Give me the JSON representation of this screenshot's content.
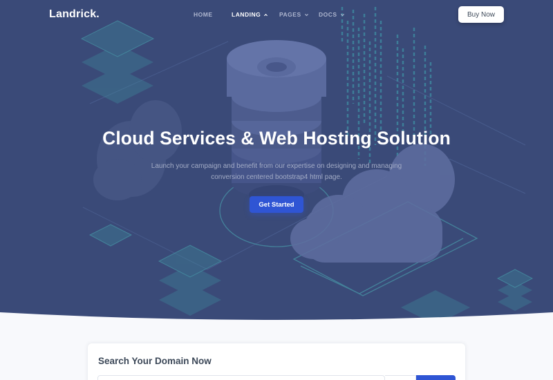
{
  "brand": {
    "name": "Landrick."
  },
  "nav": {
    "items": [
      {
        "label": "HOME",
        "has_dropdown": false,
        "active": false
      },
      {
        "label": "LANDING",
        "has_dropdown": true,
        "active": true
      },
      {
        "label": "PAGES",
        "has_dropdown": true,
        "active": false
      },
      {
        "label": "DOCS",
        "has_dropdown": true,
        "active": false
      }
    ],
    "buy_label": "Buy Now"
  },
  "hero": {
    "title": "Cloud Services & Web Hosting Solution",
    "subtitle": "Launch your campaign and benefit from our expertise on designing and managing conversion centered bootstrap4 html page.",
    "cta_label": "Get Started"
  },
  "domain_search": {
    "title": "Search Your Domain Now"
  },
  "colors": {
    "hero_bg": "#3a4a78",
    "accent": "#2f55d4",
    "page_bg": "#f8f9fc",
    "teal_line": "#47a3b0"
  }
}
